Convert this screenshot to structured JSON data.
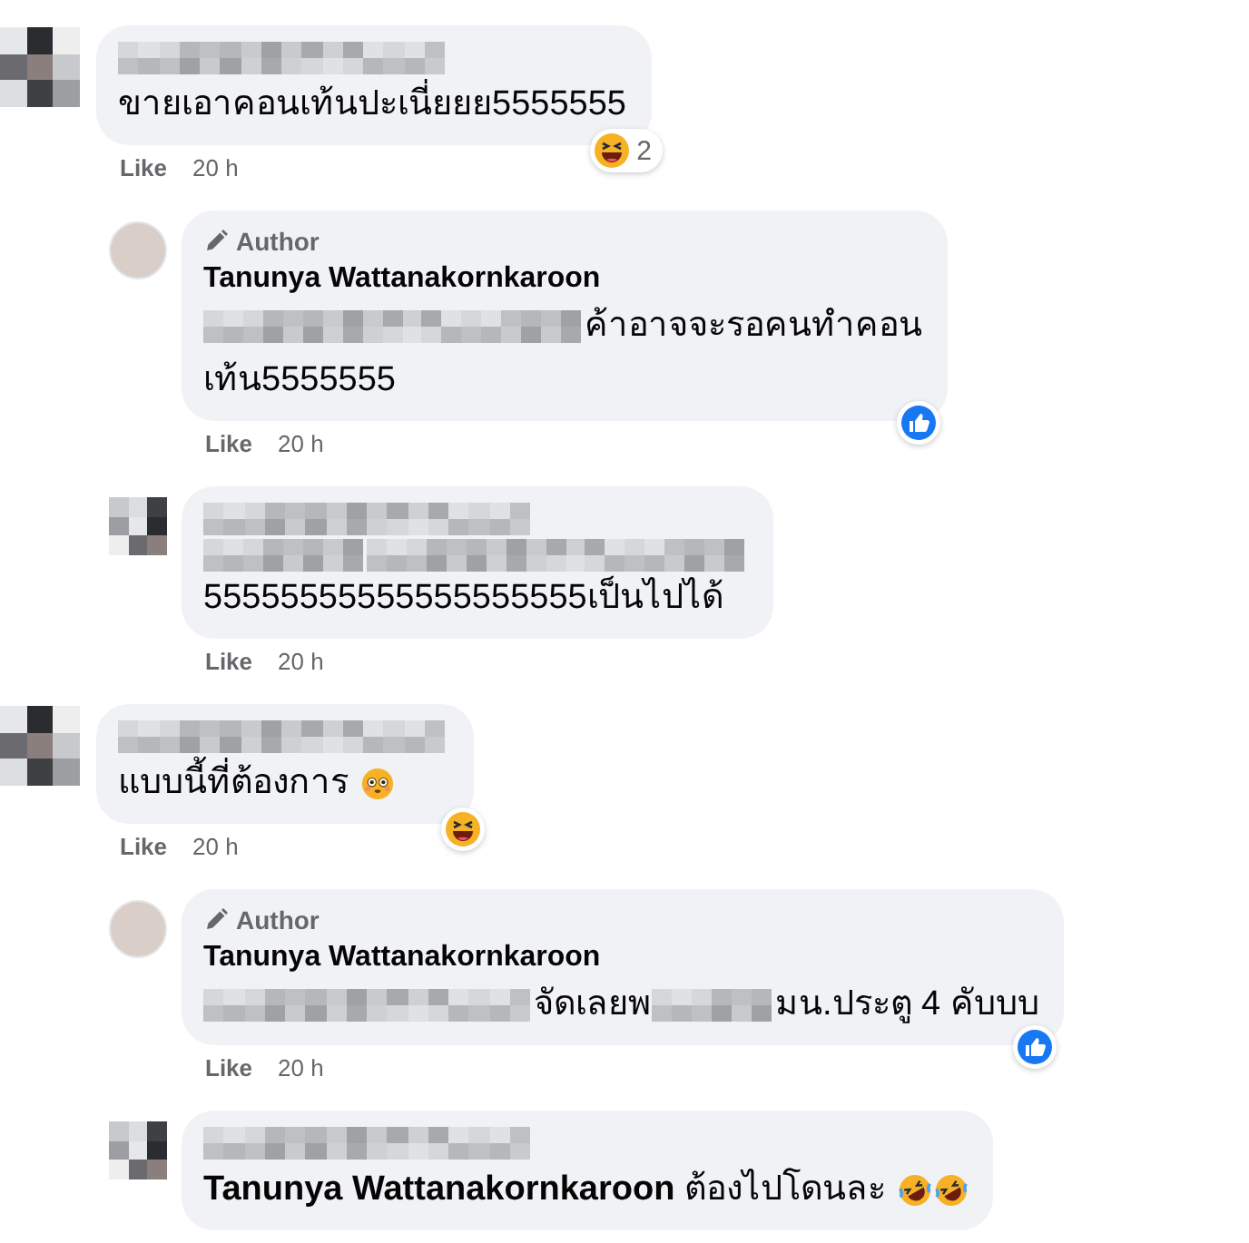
{
  "comments": [
    {
      "avatar": {
        "kind": "blurred"
      },
      "name_block": {
        "kind": "long"
      },
      "lines": [
        [
          {
            "kind": "text",
            "text": "ขายเอาคอนเท้นปะเนี่ยยย5555555"
          }
        ]
      ],
      "reaction": {
        "kind": "haha",
        "count": "2"
      },
      "actions": {
        "like": "Like",
        "time": "20 h"
      },
      "replies": [
        {
          "avatar": {
            "kind": "photo"
          },
          "author_badge": "Author",
          "name": "Tanunya Wattanakornkaroon",
          "lines": [
            [
              {
                "kind": "redacted-longer"
              },
              {
                "kind": "text",
                "text": "ค้าอาจจะรอคนทำคอน"
              }
            ],
            [
              {
                "kind": "text",
                "text": "เท้น5555555"
              }
            ]
          ],
          "reaction": {
            "kind": "like"
          },
          "actions": {
            "like": "Like",
            "time": "20 h"
          }
        },
        {
          "avatar": {
            "kind": "blurred"
          },
          "name_block": {
            "kind": "long"
          },
          "lines": [
            [
              {
                "kind": "redacted-medium"
              },
              {
                "kind": "redacted-longer"
              }
            ],
            [
              {
                "kind": "text",
                "text": "55555555555555555555เป็นไปได้"
              }
            ]
          ],
          "actions": {
            "like": "Like",
            "time": "20 h"
          }
        }
      ]
    },
    {
      "avatar": {
        "kind": "blurred"
      },
      "name_block": {
        "kind": "long"
      },
      "lines": [
        [
          {
            "kind": "text",
            "text": "แบบนี้ที่ต้องการ "
          },
          {
            "kind": "flushed-emoji"
          }
        ]
      ],
      "reaction": {
        "kind": "haha"
      },
      "actions": {
        "like": "Like",
        "time": "20 h"
      },
      "replies": [
        {
          "avatar": {
            "kind": "photo"
          },
          "author_badge": "Author",
          "name": "Tanunya Wattanakornkaroon",
          "lines": [
            [
              {
                "kind": "redacted-long"
              },
              {
                "kind": "text",
                "text": "จัดเลยพ"
              },
              {
                "kind": "redacted-short"
              },
              {
                "kind": "text",
                "text": "มน.ประตู 4 คับบบ"
              }
            ]
          ],
          "reaction": {
            "kind": "like"
          },
          "actions": {
            "like": "Like",
            "time": "20 h"
          }
        },
        {
          "avatar": {
            "kind": "blurred"
          },
          "name_block": {
            "kind": "long"
          },
          "lines": [
            [
              {
                "kind": "mention",
                "text": "Tanunya Wattanakornkaroon"
              },
              {
                "kind": "text",
                "text": " ต้องไปโดนละ "
              },
              {
                "kind": "rofl-emoji"
              },
              {
                "kind": "rofl-emoji"
              }
            ]
          ]
        }
      ]
    }
  ]
}
